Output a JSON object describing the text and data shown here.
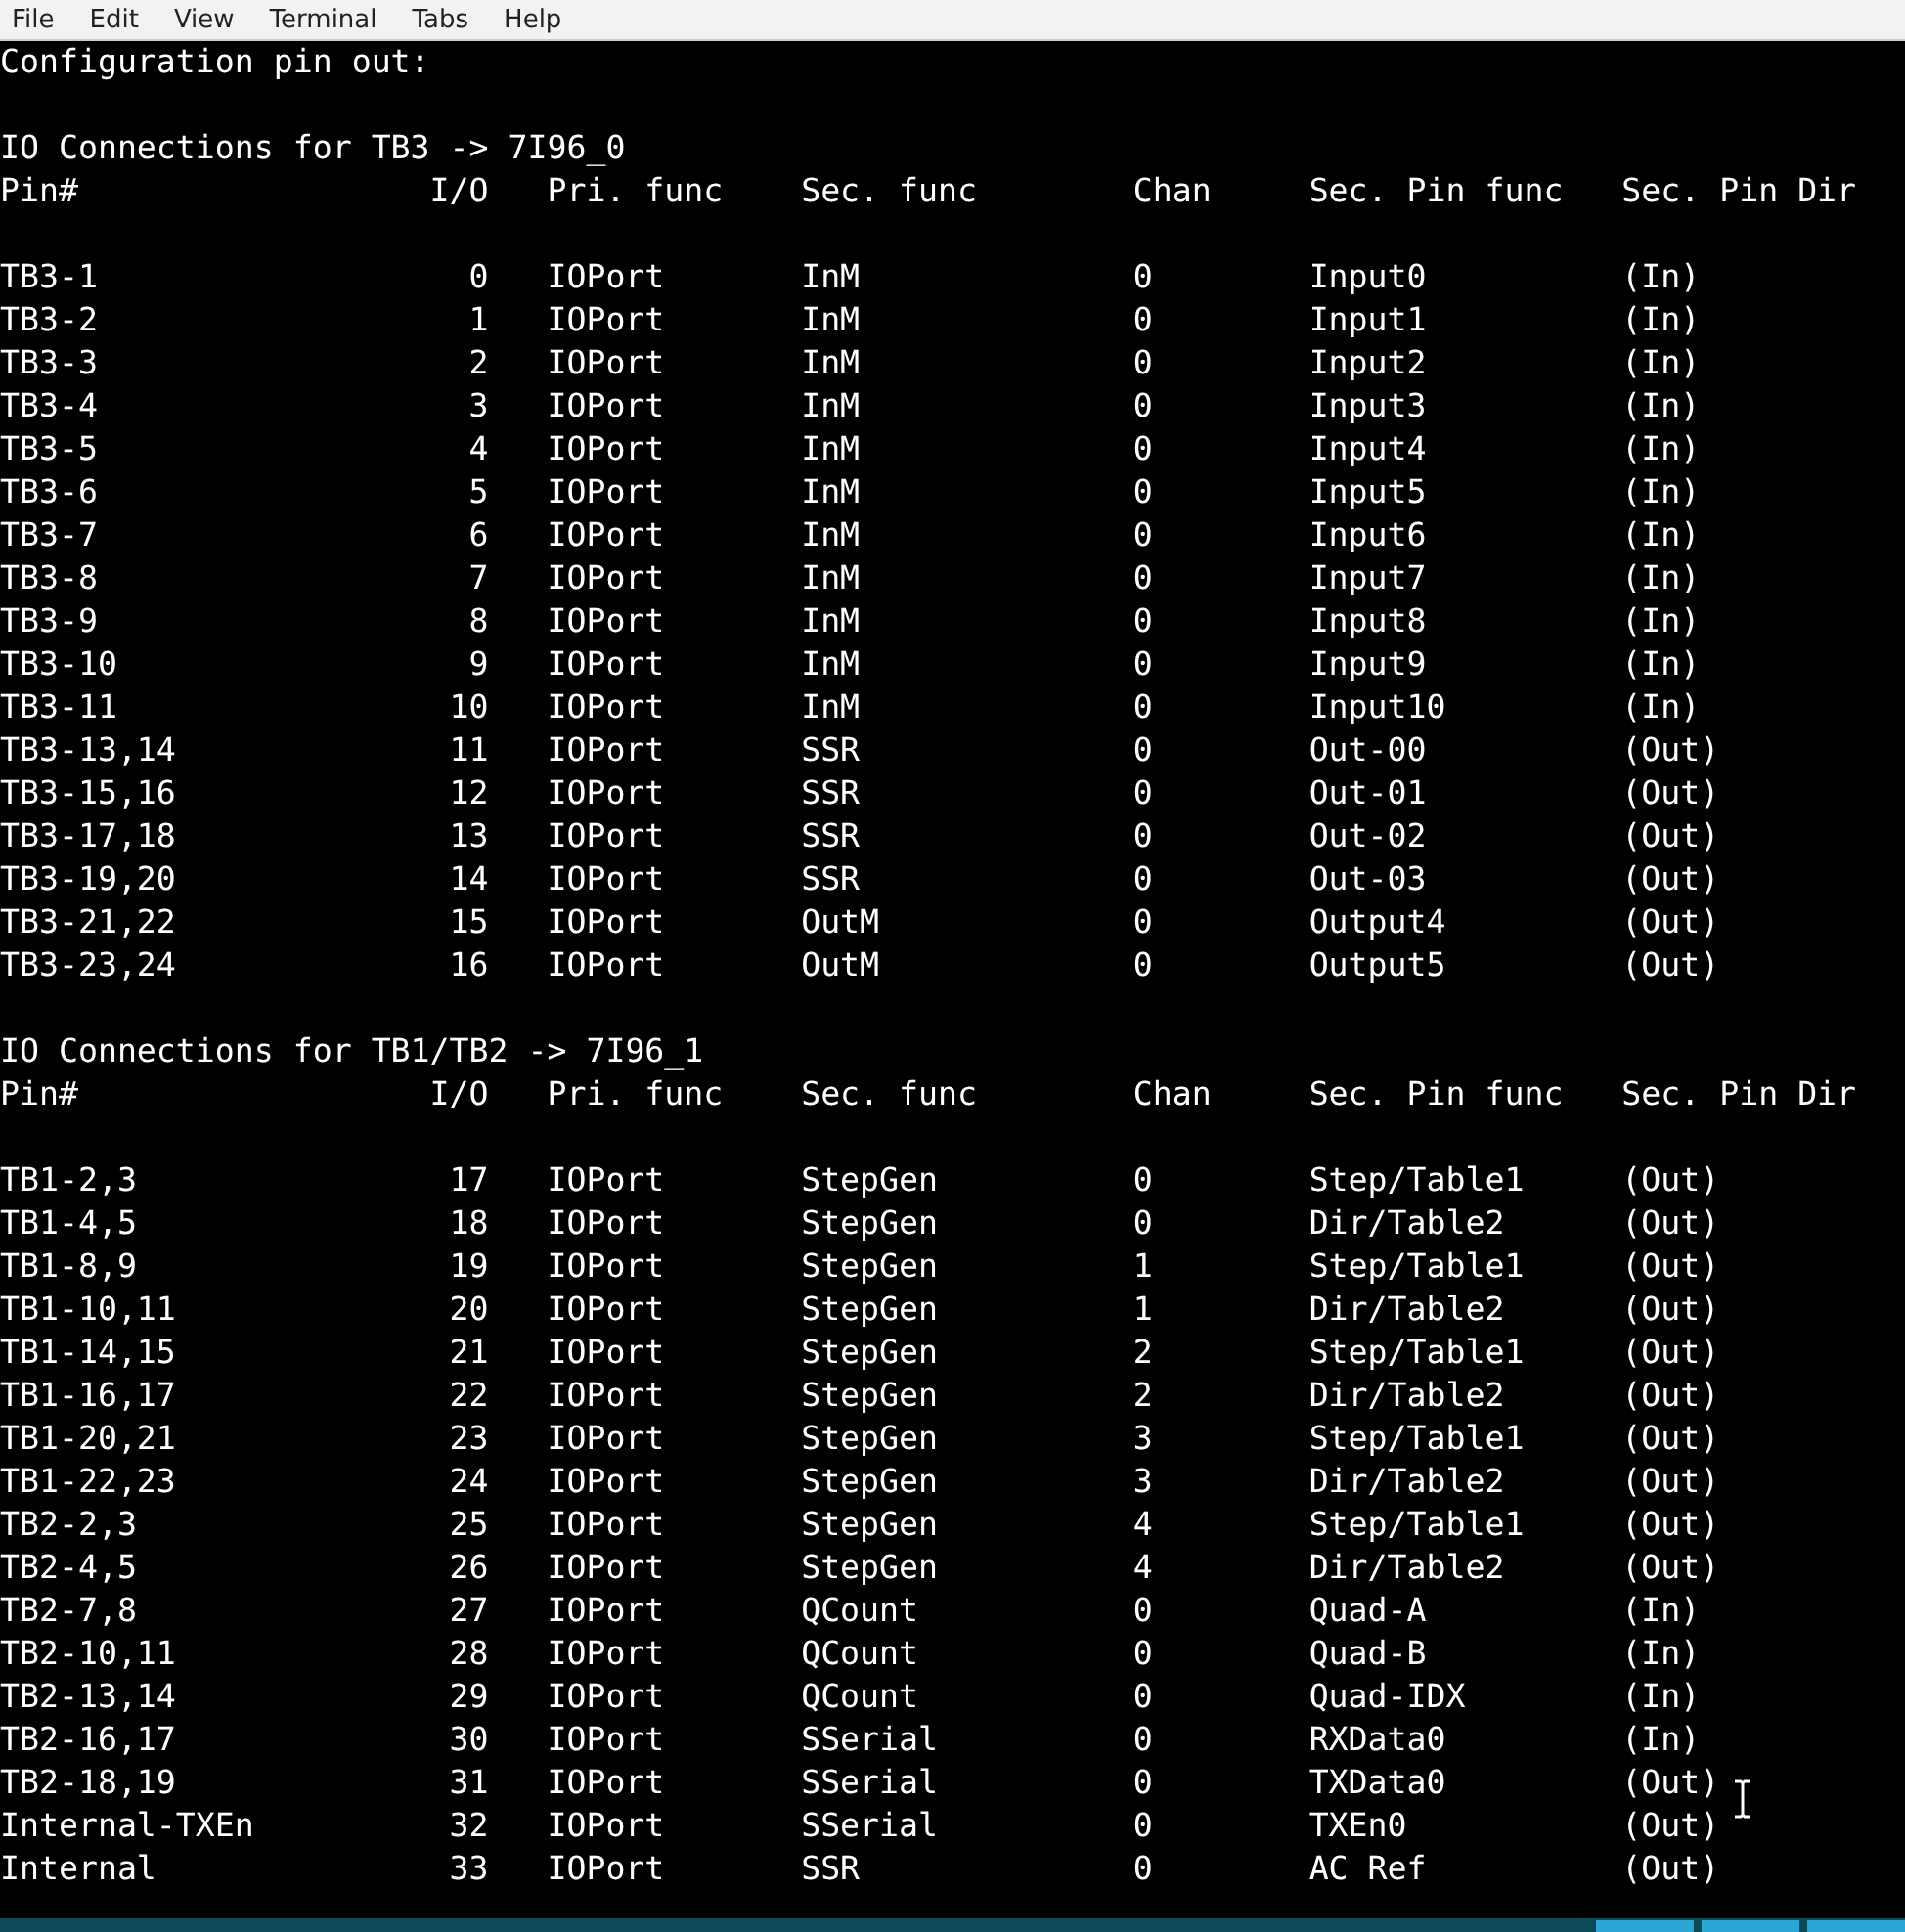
{
  "menu": [
    "File",
    "Edit",
    "View",
    "Terminal",
    "Tabs",
    "Help"
  ],
  "intro": "Configuration pin out:",
  "sections": [
    {
      "title": "IO Connections for TB3 -> 7I96_0",
      "columns": [
        "Pin#",
        "I/O",
        "Pri. func",
        "Sec. func",
        "Chan",
        "Sec. Pin func",
        "Sec. Pin Dir"
      ],
      "rows": [
        [
          "TB3-1",
          "0",
          "IOPort",
          "InM",
          "0",
          "Input0",
          "(In)"
        ],
        [
          "TB3-2",
          "1",
          "IOPort",
          "InM",
          "0",
          "Input1",
          "(In)"
        ],
        [
          "TB3-3",
          "2",
          "IOPort",
          "InM",
          "0",
          "Input2",
          "(In)"
        ],
        [
          "TB3-4",
          "3",
          "IOPort",
          "InM",
          "0",
          "Input3",
          "(In)"
        ],
        [
          "TB3-5",
          "4",
          "IOPort",
          "InM",
          "0",
          "Input4",
          "(In)"
        ],
        [
          "TB3-6",
          "5",
          "IOPort",
          "InM",
          "0",
          "Input5",
          "(In)"
        ],
        [
          "TB3-7",
          "6",
          "IOPort",
          "InM",
          "0",
          "Input6",
          "(In)"
        ],
        [
          "TB3-8",
          "7",
          "IOPort",
          "InM",
          "0",
          "Input7",
          "(In)"
        ],
        [
          "TB3-9",
          "8",
          "IOPort",
          "InM",
          "0",
          "Input8",
          "(In)"
        ],
        [
          "TB3-10",
          "9",
          "IOPort",
          "InM",
          "0",
          "Input9",
          "(In)"
        ],
        [
          "TB3-11",
          "10",
          "IOPort",
          "InM",
          "0",
          "Input10",
          "(In)"
        ],
        [
          "TB3-13,14",
          "11",
          "IOPort",
          "SSR",
          "0",
          "Out-00",
          "(Out)"
        ],
        [
          "TB3-15,16",
          "12",
          "IOPort",
          "SSR",
          "0",
          "Out-01",
          "(Out)"
        ],
        [
          "TB3-17,18",
          "13",
          "IOPort",
          "SSR",
          "0",
          "Out-02",
          "(Out)"
        ],
        [
          "TB3-19,20",
          "14",
          "IOPort",
          "SSR",
          "0",
          "Out-03",
          "(Out)"
        ],
        [
          "TB3-21,22",
          "15",
          "IOPort",
          "OutM",
          "0",
          "Output4",
          "(Out)"
        ],
        [
          "TB3-23,24",
          "16",
          "IOPort",
          "OutM",
          "0",
          "Output5",
          "(Out)"
        ]
      ]
    },
    {
      "title": "IO Connections for TB1/TB2 -> 7I96_1",
      "columns": [
        "Pin#",
        "I/O",
        "Pri. func",
        "Sec. func",
        "Chan",
        "Sec. Pin func",
        "Sec. Pin Dir"
      ],
      "rows": [
        [
          "TB1-2,3",
          "17",
          "IOPort",
          "StepGen",
          "0",
          "Step/Table1",
          "(Out)"
        ],
        [
          "TB1-4,5",
          "18",
          "IOPort",
          "StepGen",
          "0",
          "Dir/Table2",
          "(Out)"
        ],
        [
          "TB1-8,9",
          "19",
          "IOPort",
          "StepGen",
          "1",
          "Step/Table1",
          "(Out)"
        ],
        [
          "TB1-10,11",
          "20",
          "IOPort",
          "StepGen",
          "1",
          "Dir/Table2",
          "(Out)"
        ],
        [
          "TB1-14,15",
          "21",
          "IOPort",
          "StepGen",
          "2",
          "Step/Table1",
          "(Out)"
        ],
        [
          "TB1-16,17",
          "22",
          "IOPort",
          "StepGen",
          "2",
          "Dir/Table2",
          "(Out)"
        ],
        [
          "TB1-20,21",
          "23",
          "IOPort",
          "StepGen",
          "3",
          "Step/Table1",
          "(Out)"
        ],
        [
          "TB1-22,23",
          "24",
          "IOPort",
          "StepGen",
          "3",
          "Dir/Table2",
          "(Out)"
        ],
        [
          "TB2-2,3",
          "25",
          "IOPort",
          "StepGen",
          "4",
          "Step/Table1",
          "(Out)"
        ],
        [
          "TB2-4,5",
          "26",
          "IOPort",
          "StepGen",
          "4",
          "Dir/Table2",
          "(Out)"
        ],
        [
          "TB2-7,8",
          "27",
          "IOPort",
          "QCount",
          "0",
          "Quad-A",
          "(In)"
        ],
        [
          "TB2-10,11",
          "28",
          "IOPort",
          "QCount",
          "0",
          "Quad-B",
          "(In)"
        ],
        [
          "TB2-13,14",
          "29",
          "IOPort",
          "QCount",
          "0",
          "Quad-IDX",
          "(In)"
        ],
        [
          "TB2-16,17",
          "30",
          "IOPort",
          "SSerial",
          "0",
          "RXData0",
          "(In)"
        ],
        [
          "TB2-18,19",
          "31",
          "IOPort",
          "SSerial",
          "0",
          "TXData0",
          "(Out)"
        ],
        [
          "Internal-TXEn",
          "32",
          "IOPort",
          "SSerial",
          "0",
          "TXEn0",
          "(Out)"
        ],
        [
          "Internal",
          "33",
          "IOPort",
          "SSR",
          "0",
          "AC Ref",
          "(Out)"
        ]
      ]
    }
  ]
}
